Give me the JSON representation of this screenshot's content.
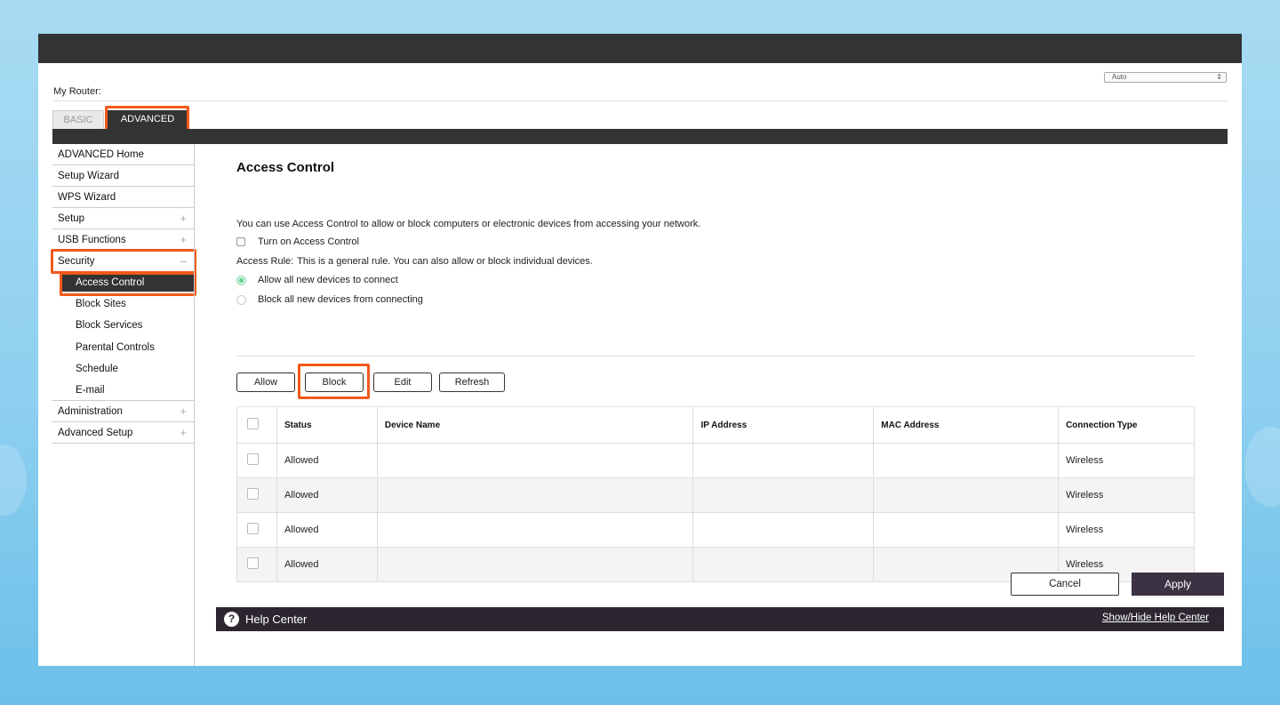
{
  "language_select": {
    "value": "Auto"
  },
  "router_label": "My Router:",
  "tabs": [
    {
      "label": "BASIC",
      "active": false
    },
    {
      "label": "ADVANCED",
      "active": true
    }
  ],
  "sidebar": {
    "items": [
      {
        "label": "ADVANCED Home"
      },
      {
        "label": "Setup Wizard"
      },
      {
        "label": "WPS Wizard"
      },
      {
        "label": "Setup",
        "expander": "+"
      },
      {
        "label": "USB Functions",
        "expander": "+"
      },
      {
        "label": "Security",
        "expander": "–"
      }
    ],
    "security_sub": [
      {
        "label": "Access Control",
        "active": true
      },
      {
        "label": "Block Sites"
      },
      {
        "label": "Block Services"
      },
      {
        "label": "Parental Controls"
      },
      {
        "label": "Schedule"
      },
      {
        "label": "E-mail"
      }
    ],
    "items_after": [
      {
        "label": "Administration",
        "expander": "+"
      },
      {
        "label": "Advanced Setup",
        "expander": "+"
      }
    ]
  },
  "main": {
    "title": "Access Control",
    "description": "You can use Access Control to allow or block computers or electronic devices from accessing your network.",
    "turn_on_label": "Turn on Access Control",
    "access_rule_label": "Access Rule:",
    "access_rule_text": "This is a general rule. You can also allow or block individual devices.",
    "radio_allow": "Allow all new devices to connect",
    "radio_block": "Block all new devices from connecting",
    "buttons": {
      "allow": "Allow",
      "block": "Block",
      "edit": "Edit",
      "refresh": "Refresh"
    },
    "table": {
      "headers": [
        "Status",
        "Device Name",
        "IP Address",
        "MAC Address",
        "Connection Type"
      ],
      "rows": [
        {
          "status": "Allowed",
          "device": "",
          "ip": "",
          "mac": "",
          "type": "Wireless"
        },
        {
          "status": "Allowed",
          "device": "",
          "ip": "",
          "mac": "",
          "type": "Wireless"
        },
        {
          "status": "Allowed",
          "device": "",
          "ip": "",
          "mac": "",
          "type": "Wireless"
        },
        {
          "status": "Allowed",
          "device": "",
          "ip": "",
          "mac": "",
          "type": "Wireless"
        }
      ]
    },
    "cancel_label": "Cancel",
    "apply_label": "Apply"
  },
  "help": {
    "title": "Help Center",
    "icon": "?",
    "toggle_link": "Show/Hide Help Center"
  },
  "colors": {
    "highlight": "#f1591a",
    "allowed": "#1b8a1b",
    "dark": "#333333",
    "apply": "#3b3344"
  }
}
